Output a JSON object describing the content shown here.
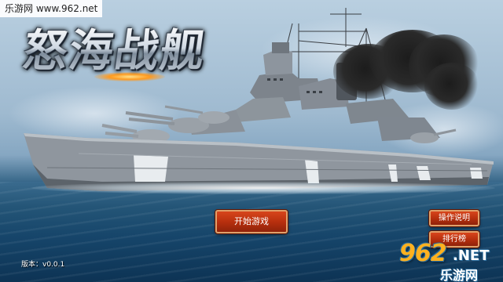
{
  "watermark_top": "乐游网 www.962.net",
  "title": "怒海战舰",
  "buttons": {
    "start": "开始游戏",
    "manual": "操作说明",
    "rank": "排行榜"
  },
  "version_label": "版本：v0.0.1",
  "watermark_bottom": {
    "logo_digits": "962",
    "logo_suffix": ".NET",
    "logo_sub": "乐游网"
  },
  "colors": {
    "button_red": "#b8300e",
    "button_border": "#e0a06a",
    "logo_orange": "#ffb11f"
  },
  "icons": [
    "warship-illustration",
    "smoke-plume",
    "962-logo"
  ]
}
